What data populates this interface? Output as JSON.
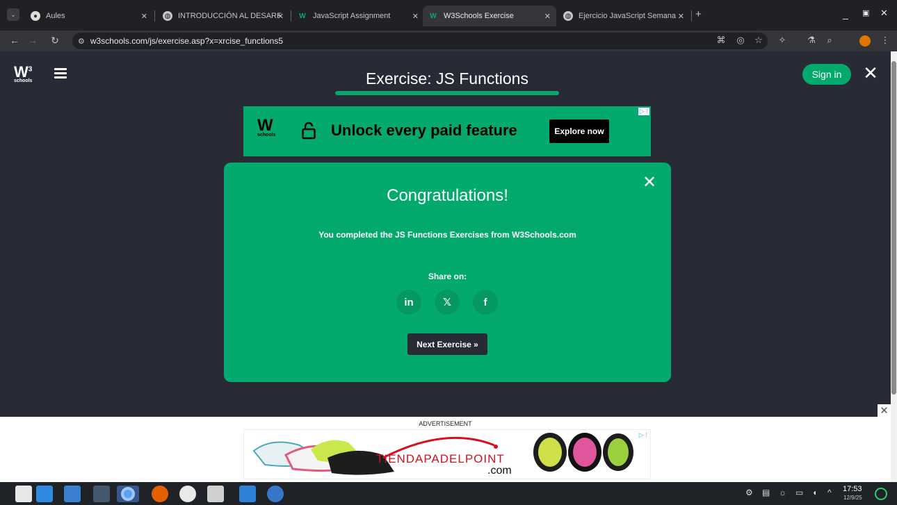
{
  "browser": {
    "tabs": [
      {
        "label": "Aules"
      },
      {
        "label": "INTRODUCCIÓN AL DESARF"
      },
      {
        "label": "JavaScript Assignment"
      },
      {
        "label": "W3Schools Exercise"
      },
      {
        "label": "Ejercicio JavaScript Semana"
      }
    ],
    "url": "w3schools.com/js/exercise.asp?x=xrcise_functions5"
  },
  "page": {
    "logo_text": "schools",
    "logo_super": "3",
    "title": "Exercise: JS Functions",
    "signin_label": "Sign in"
  },
  "ad_top": {
    "logo_text": "schools",
    "headline": "Unlock every paid feature",
    "cta": "Explore now"
  },
  "modal": {
    "title": "Congratulations!",
    "message": "You completed the JS Functions Exercises from W3Schools.com",
    "share_label": "Share on:",
    "share_icons": [
      "in",
      "𝕏",
      "f"
    ],
    "next_label": "Next Exercise »"
  },
  "ad_bottom": {
    "label": "ADVERTISEMENT",
    "brand": "TIENDAPADELPOINT",
    "brand_suffix": ".com"
  },
  "taskbar": {
    "time": "17:53",
    "date": "12/9/25"
  },
  "colors": {
    "accent": "#04aa6d",
    "page_bg": "#282a35"
  }
}
